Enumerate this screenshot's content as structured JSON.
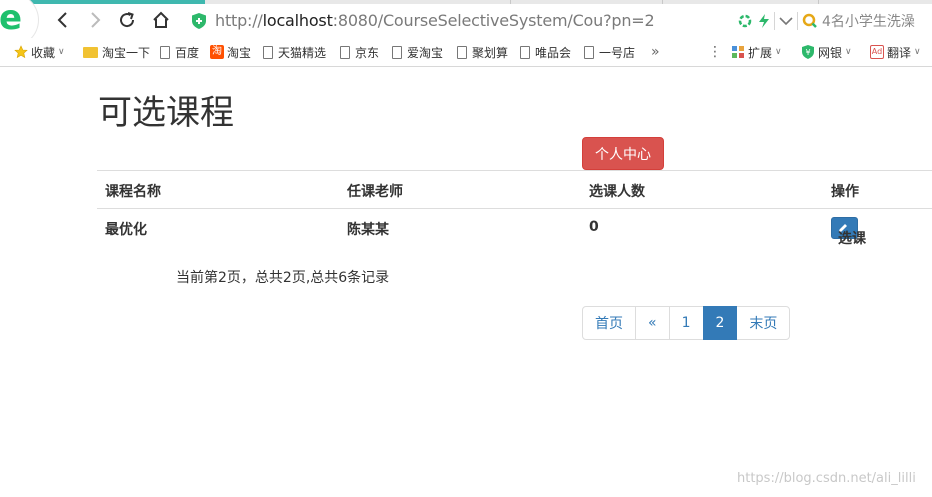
{
  "browser": {
    "url_prefix": "http://",
    "url_host": "localhost",
    "url_rest": ":8080/CourseSelectiveSystem/Cou?pn=2",
    "search_text": "4名小学生洗澡",
    "bookmarks": [
      {
        "label": "收藏",
        "icon": "star-icon"
      },
      {
        "label": "淘宝一下",
        "icon": "folder-icon"
      },
      {
        "label": "百度",
        "icon": "page-icon"
      },
      {
        "label": "淘宝",
        "icon": "taobao-icon"
      },
      {
        "label": "天猫精选",
        "icon": "page-icon"
      },
      {
        "label": "京东",
        "icon": "page-icon"
      },
      {
        "label": "爱淘宝",
        "icon": "page-icon"
      },
      {
        "label": "聚划算",
        "icon": "page-icon"
      },
      {
        "label": "唯品会",
        "icon": "page-icon"
      },
      {
        "label": "一号店",
        "icon": "page-icon"
      }
    ],
    "more": "»",
    "extensions_label": "扩展",
    "bank_label": "网银",
    "translate_label": "翻译"
  },
  "page": {
    "title": "可选课程",
    "personal_center": "个人中心",
    "table": {
      "headers": [
        "课程名称",
        "任课老师",
        "选课人数",
        "操作"
      ],
      "rows": [
        {
          "course": "最优化",
          "teacher": "陈某某",
          "count": "0",
          "action": "选课"
        }
      ]
    },
    "info": "当前第2页，总共2页,总共6条记录",
    "pagination": [
      "首页",
      "«",
      "1",
      "2",
      "末页"
    ],
    "active_page": "2"
  },
  "watermark": "https://blog.csdn.net/ali_lilli",
  "colors": {
    "danger": "#d9534f",
    "primary": "#337ab7",
    "browser_green": "#1ec06d"
  }
}
